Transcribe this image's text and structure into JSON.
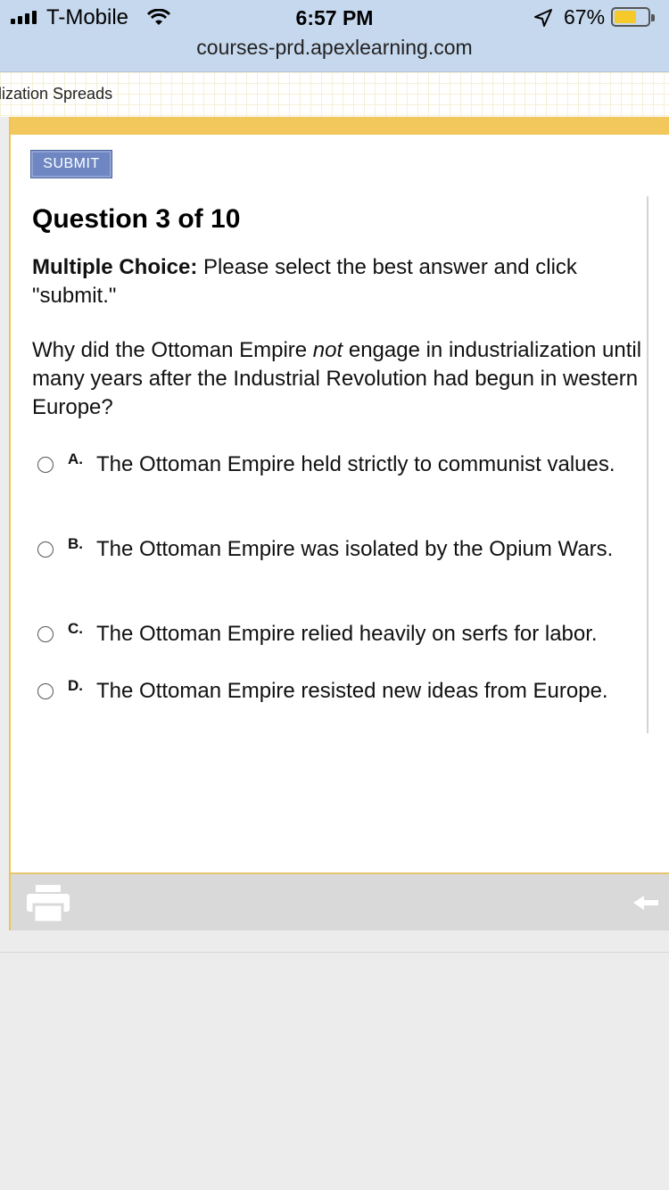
{
  "status_bar": {
    "carrier": "T-Mobile",
    "time": "6:57 PM",
    "battery_percent": "67%",
    "battery_level": 0.67,
    "icons": [
      "signal-icon",
      "wifi-icon",
      "location-icon",
      "battery-icon"
    ]
  },
  "browser": {
    "url": "courses-prd.apexlearning.com"
  },
  "header": {
    "breadcrumb": "lization Spreads"
  },
  "toolbar": {
    "submit_label": "SUBMIT"
  },
  "question": {
    "title": "Question 3 of 10",
    "instruction_bold": "Multiple Choice:",
    "instruction_rest": " Please select the best answer and click \"submit.\"",
    "stem_before": "Why did the Ottoman Empire ",
    "stem_italic": "not",
    "stem_after": " engage in industrialization until many years after the Industrial Revolution had begun in western Europe?",
    "options": [
      {
        "letter": "A.",
        "text": "The Ottoman Empire held strictly to communist values.",
        "selected": false
      },
      {
        "letter": "B.",
        "text": "The Ottoman Empire was isolated by the Opium Wars.",
        "selected": false
      },
      {
        "letter": "C.",
        "text": "The Ottoman Empire relied heavily on serfs for labor.",
        "selected": false
      },
      {
        "letter": "D.",
        "text": "The Ottoman Empire resisted new ideas from Europe.",
        "selected": false
      }
    ]
  },
  "footer": {
    "icons": [
      "print-icon",
      "back-arrow-icon"
    ]
  },
  "colors": {
    "accent_gold": "#f2c75b",
    "submit_blue": "#6e87c2",
    "status_bar_bg": "#c6d8ee"
  }
}
